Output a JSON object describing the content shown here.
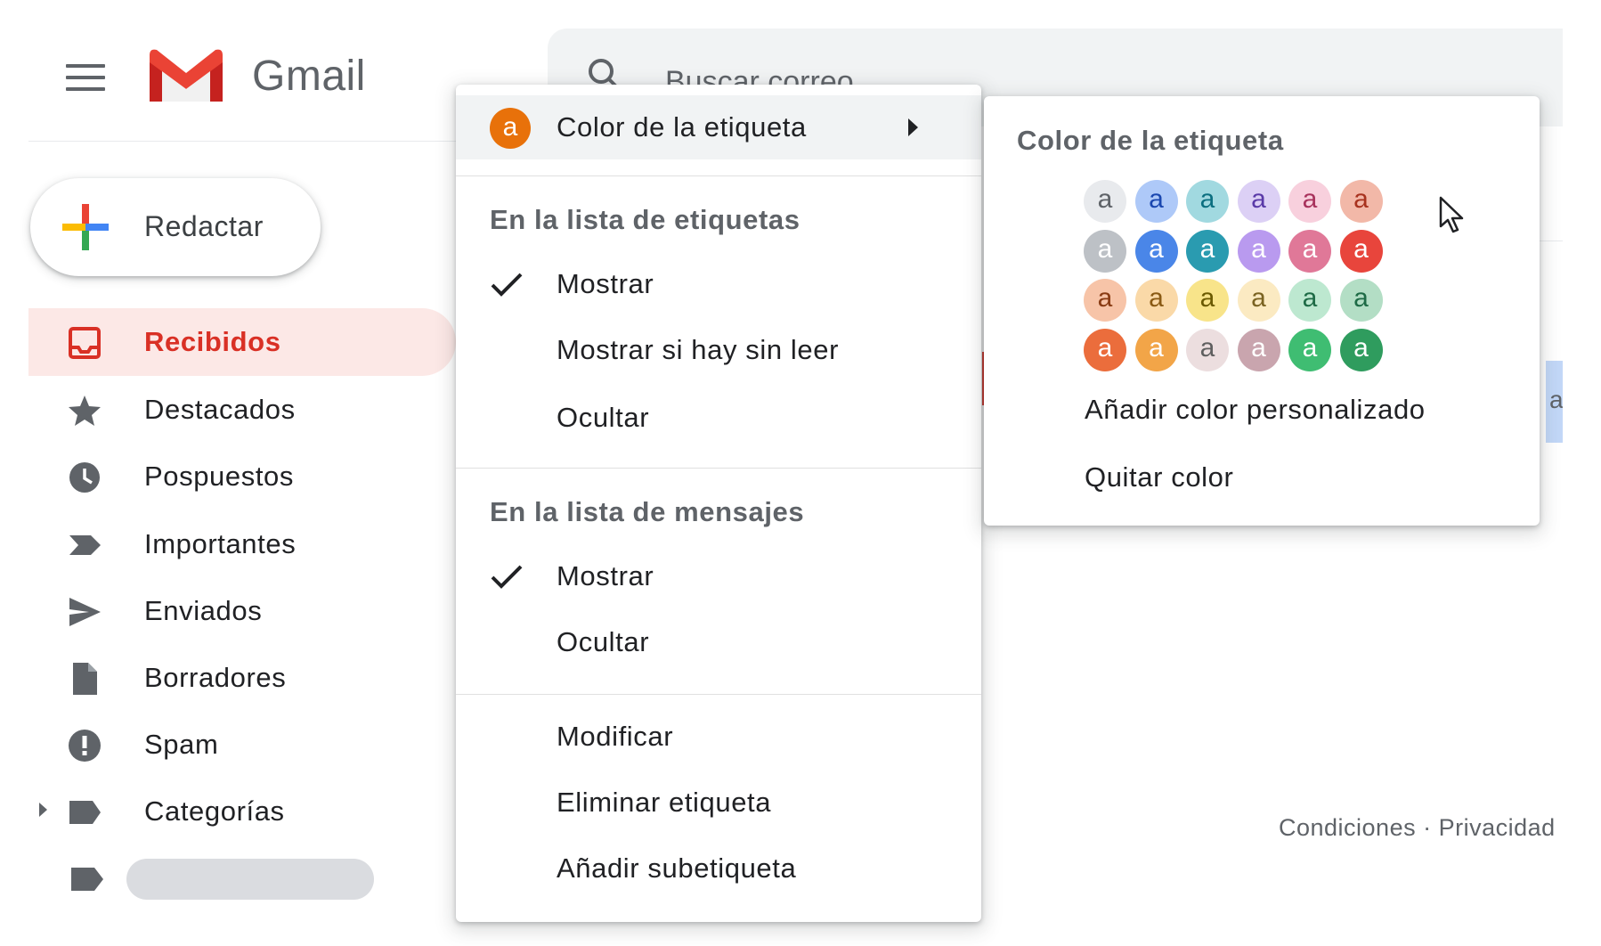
{
  "header": {
    "app_name": "Gmail",
    "search_placeholder": "Buscar correo"
  },
  "compose": {
    "label": "Redactar"
  },
  "nav": [
    {
      "label": "Recibidos",
      "icon": "inbox-icon",
      "active": true
    },
    {
      "label": "Destacados",
      "icon": "star-icon"
    },
    {
      "label": "Pospuestos",
      "icon": "clock-icon"
    },
    {
      "label": "Importantes",
      "icon": "important-icon"
    },
    {
      "label": "Enviados",
      "icon": "send-icon"
    },
    {
      "label": "Borradores",
      "icon": "draft-icon"
    },
    {
      "label": "Spam",
      "icon": "spam-icon"
    },
    {
      "label": "Categorías",
      "icon": "label-icon"
    }
  ],
  "menu": {
    "color_item": {
      "label": "Color de la etiqueta",
      "swatch_letter": "a",
      "swatch_color": "#e8710a"
    },
    "label_list_heading": "En la lista de etiquetas",
    "label_list_options": [
      {
        "label": "Mostrar",
        "checked": true
      },
      {
        "label": "Mostrar si hay sin leer",
        "checked": false
      },
      {
        "label": "Ocultar",
        "checked": false
      }
    ],
    "message_list_heading": "En la lista de mensajes",
    "message_list_options": [
      {
        "label": "Mostrar",
        "checked": true
      },
      {
        "label": "Ocultar",
        "checked": false
      }
    ],
    "actions": [
      {
        "label": "Modificar"
      },
      {
        "label": "Eliminar etiqueta"
      },
      {
        "label": "Añadir subetiqueta"
      }
    ]
  },
  "color_submenu": {
    "title": "Color de la etiqueta",
    "swatch_letter": "a",
    "swatches": [
      [
        {
          "bg": "#e8eaed",
          "fg": "#5f6368"
        },
        {
          "bg": "#aec9f8",
          "fg": "#1a47b0"
        },
        {
          "bg": "#a1d9e0",
          "fg": "#0b6f80"
        },
        {
          "bg": "#dcd0f5",
          "fg": "#5a3aa8"
        },
        {
          "bg": "#f8d0dd",
          "fg": "#a8325c"
        },
        {
          "bg": "#f2b8a8",
          "fg": "#a8321e"
        }
      ],
      [
        {
          "bg": "#bdc1c6",
          "fg": "#ffffff"
        },
        {
          "bg": "#4a86e8",
          "fg": "#ffffff"
        },
        {
          "bg": "#2a9bb0",
          "fg": "#ffffff"
        },
        {
          "bg": "#b99aef",
          "fg": "#ffffff"
        },
        {
          "bg": "#e07898",
          "fg": "#ffffff"
        },
        {
          "bg": "#e8453c",
          "fg": "#ffffff"
        }
      ],
      [
        {
          "bg": "#f7c4a8",
          "fg": "#8a3c14"
        },
        {
          "bg": "#fad9a8",
          "fg": "#8a5a14"
        },
        {
          "bg": "#f8e48a",
          "fg": "#6b5a00"
        },
        {
          "bg": "#fbeac2",
          "fg": "#7a6322"
        },
        {
          "bg": "#bde8d0",
          "fg": "#1e6b46"
        },
        {
          "bg": "#b3dec5",
          "fg": "#1e6b46"
        }
      ],
      [
        {
          "bg": "#eb6d3c",
          "fg": "#ffffff"
        },
        {
          "bg": "#f2a548",
          "fg": "#ffffff"
        },
        {
          "bg": "#ecdedf",
          "fg": "#5f5f5f"
        },
        {
          "bg": "#c9a5ae",
          "fg": "#ffffff"
        },
        {
          "bg": "#3fbd72",
          "fg": "#ffffff"
        },
        {
          "bg": "#2f9c5e",
          "fg": "#ffffff"
        }
      ]
    ],
    "add_custom": "Añadir color personalizado",
    "remove": "Quitar color"
  },
  "footer": {
    "links": "Condiciones · Privacidad"
  },
  "partial_letter": "a",
  "colors": {
    "accent_red": "#d93025",
    "active_bg": "#fce8e6",
    "text_muted": "#5f6368"
  }
}
